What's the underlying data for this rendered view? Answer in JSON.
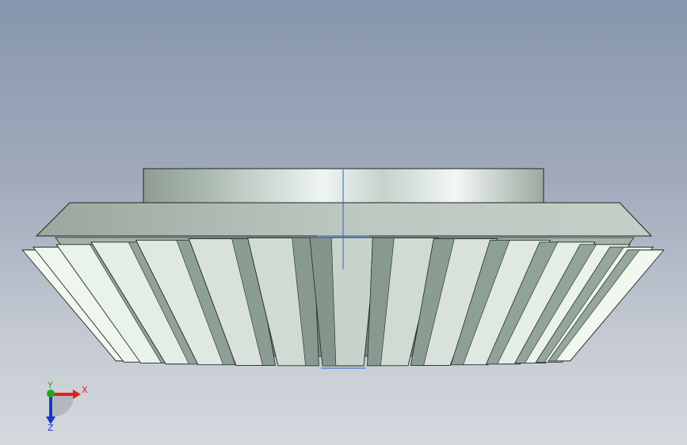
{
  "viewport": {
    "background_top": "#8796ad",
    "background_bottom": "#d6d9de"
  },
  "model": {
    "part_type": "bevel-gear",
    "tooth_count_visible": 15,
    "face_color": "#b7c5bb",
    "highlight_color": "#eef5f3",
    "edge_color": "#1f2622",
    "sketch_line_color": "#2e62c8"
  },
  "triad": {
    "x_label": "X",
    "y_label": "Y",
    "z_label": "Z",
    "x_color": "#e0201c",
    "y_color": "#1fa81f",
    "z_color": "#1a37c8"
  }
}
